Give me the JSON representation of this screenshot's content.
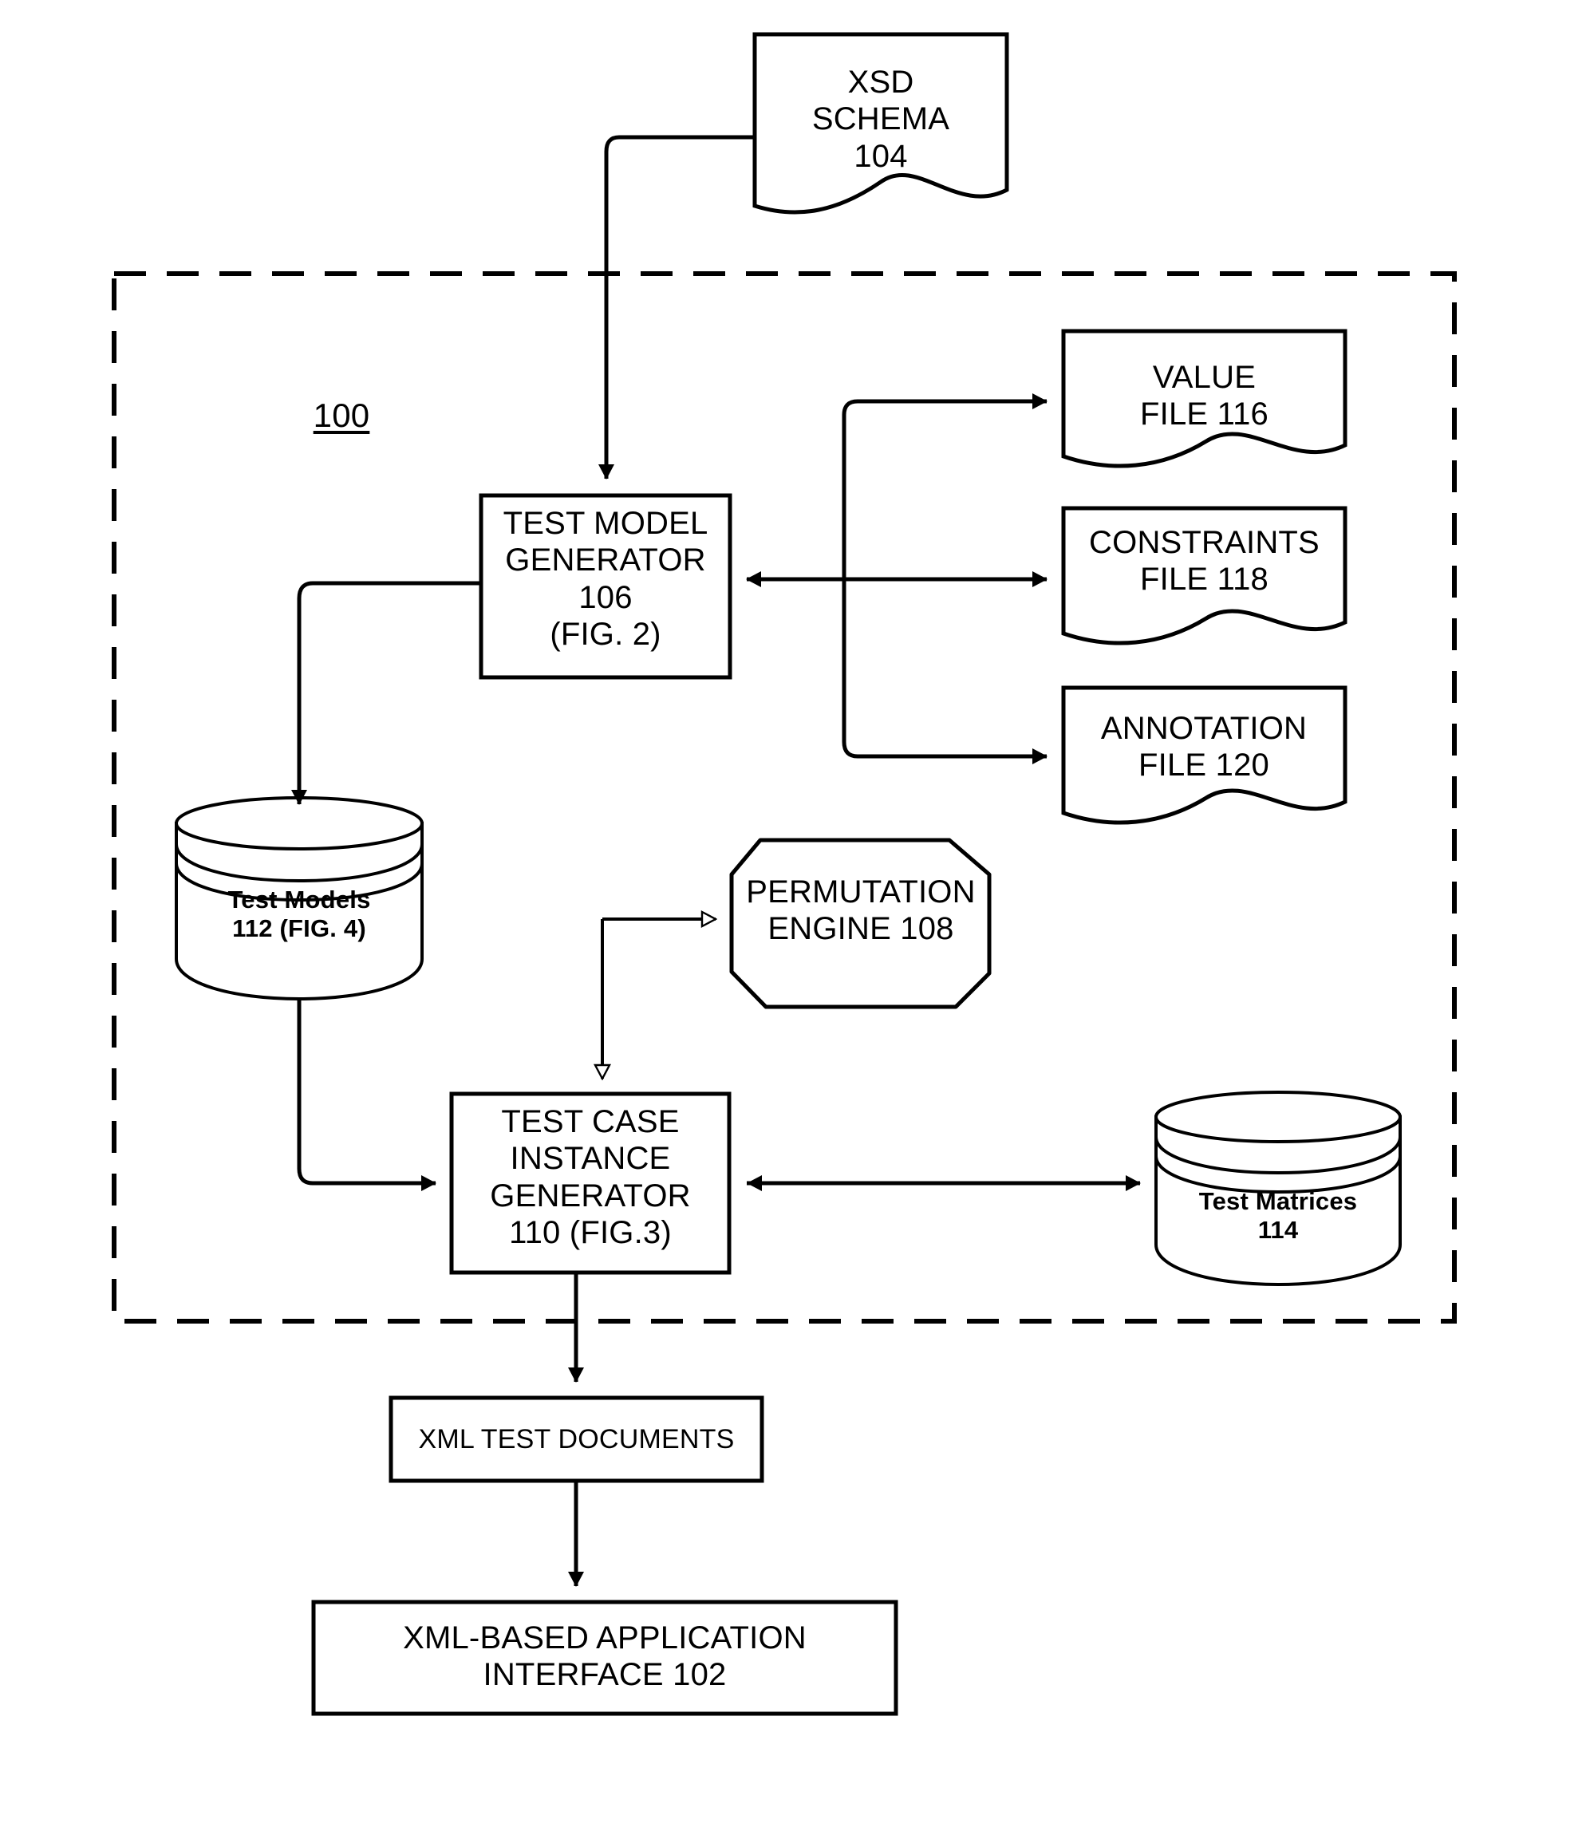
{
  "figure": {
    "system_reference": "100",
    "boundary_style": "dashed"
  },
  "nodes": {
    "xsd_schema": {
      "shape": "document",
      "text": "XSD\nSCHEMA\n104",
      "reference": "104"
    },
    "test_model_generator": {
      "shape": "rectangle",
      "text": "TEST MODEL\nGENERATOR\n106\n(FIG. 2)",
      "reference": "106"
    },
    "value_file": {
      "shape": "document",
      "text": "VALUE\nFILE 116",
      "reference": "116"
    },
    "constraints_file": {
      "shape": "document",
      "text": "CONSTRAINTS\nFILE 118",
      "reference": "118"
    },
    "annotation_file": {
      "shape": "document",
      "text": "ANNOTATION\nFILE 120",
      "reference": "120"
    },
    "test_models_db": {
      "shape": "cylinder",
      "text": "Test Models\n112 (FIG. 4)",
      "reference": "112"
    },
    "permutation_engine": {
      "shape": "rounded-rectangle",
      "text": "PERMUTATION\nENGINE 108",
      "reference": "108"
    },
    "test_case_instance_generator": {
      "shape": "rectangle",
      "text": "TEST CASE\nINSTANCE\nGENERATOR\n110 (FIG.3)",
      "reference": "110"
    },
    "test_matrices_db": {
      "shape": "cylinder",
      "text": "Test Matrices\n114",
      "reference": "114"
    },
    "xml_test_documents": {
      "shape": "rectangle",
      "text": "XML TEST DOCUMENTS"
    },
    "xml_based_application_interface": {
      "shape": "rectangle",
      "text": "XML-BASED APPLICATION\nINTERFACE 102",
      "reference": "102"
    }
  },
  "edges": [
    {
      "name": "xsd-schema-to-test-model-generator",
      "from": "xsd_schema",
      "to": "test_model_generator",
      "arrow": "filled"
    },
    {
      "name": "test-model-generator-to-test-models-db",
      "from": "test_model_generator",
      "to": "test_models_db",
      "arrow": "filled"
    },
    {
      "name": "value-file-branch",
      "from": "test_model_generator",
      "to": "value_file",
      "arrow": "filled"
    },
    {
      "name": "constraints-file-branch",
      "from": "test_model_generator",
      "to": "constraints_file",
      "arrow": "filled-both"
    },
    {
      "name": "annotation-file-branch",
      "from": "test_model_generator",
      "to": "annotation_file",
      "arrow": "filled"
    },
    {
      "name": "test-models-db-to-test-case-generator",
      "from": "test_models_db",
      "to": "test_case_instance_generator",
      "arrow": "filled"
    },
    {
      "name": "permutation-engine-link",
      "from": "test_case_instance_generator",
      "to": "permutation_engine",
      "arrow": "hollow-both"
    },
    {
      "name": "test-case-generator-to-test-matrices",
      "from": "test_case_instance_generator",
      "to": "test_matrices_db",
      "arrow": "filled-both"
    },
    {
      "name": "test-case-generator-to-xml-test-documents",
      "from": "test_case_instance_generator",
      "to": "xml_test_documents",
      "arrow": "filled"
    },
    {
      "name": "xml-test-documents-to-interface",
      "from": "xml_test_documents",
      "to": "xml_based_application_interface",
      "arrow": "filled"
    }
  ],
  "colors": {
    "stroke": "#000000",
    "background": "#ffffff"
  }
}
